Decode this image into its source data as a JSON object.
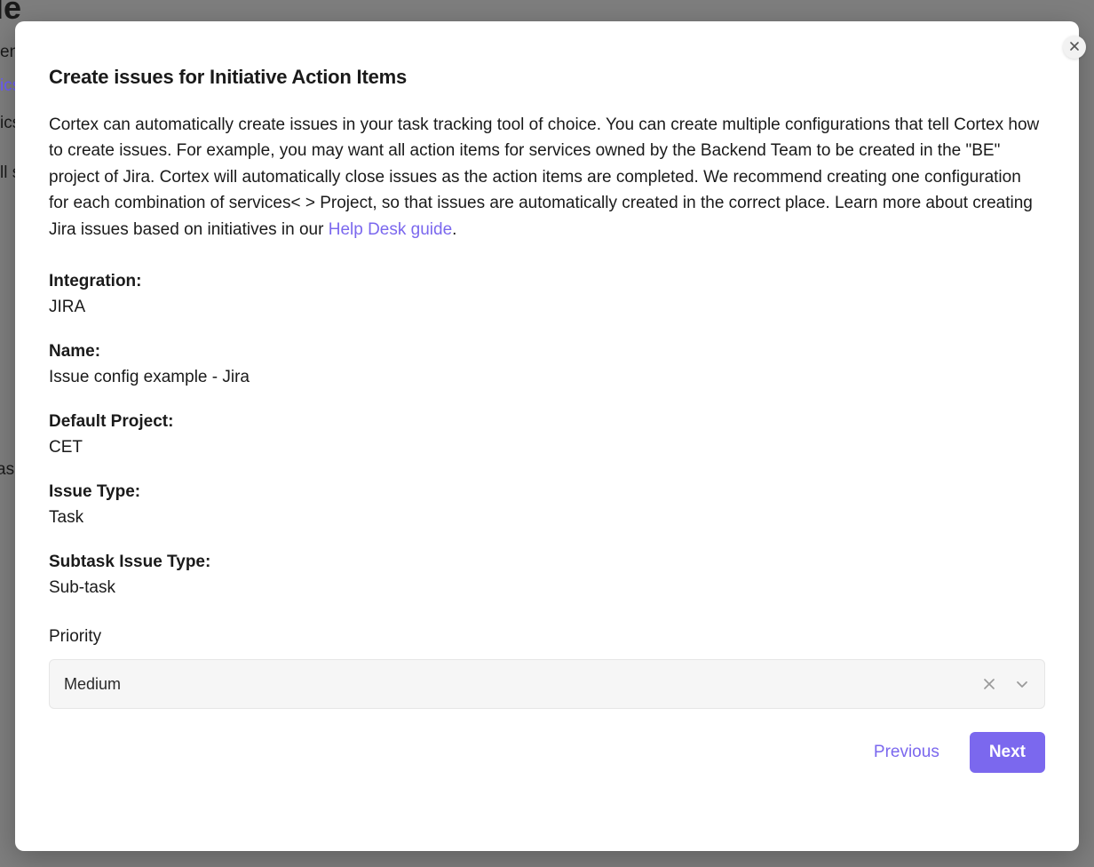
{
  "background": {
    "heading_fragment": "ample",
    "text1": "en",
    "text2": "ics",
    "text3": "ics",
    "text4": "ll s",
    "text5": "as"
  },
  "modal": {
    "title": "Create issues for Initiative Action Items",
    "description_part1": "Cortex can automatically create issues in your task tracking tool of choice. You can create multiple configurations that tell Cortex how to create issues. For example, you may want all action items for services owned by the Backend Team to be created in the \"BE\" project of Jira. Cortex will automatically close issues as the action items are completed. We recommend creating one configuration for each combination of services< > Project, so that issues are automatically created in the correct place. Learn more about creating Jira issues based on initiatives in our ",
    "help_link_text": "Help Desk guide",
    "description_part2": ".",
    "fields": {
      "integration": {
        "label": "Integration:",
        "value": "JIRA"
      },
      "name": {
        "label": "Name:",
        "value": "Issue config example - Jira"
      },
      "default_project": {
        "label": "Default Project:",
        "value": "CET"
      },
      "issue_type": {
        "label": "Issue Type:",
        "value": "Task"
      },
      "subtask_issue_type": {
        "label": "Subtask Issue Type:",
        "value": "Sub-task"
      }
    },
    "priority": {
      "label": "Priority",
      "selected": "Medium"
    },
    "buttons": {
      "previous": "Previous",
      "next": "Next"
    }
  }
}
